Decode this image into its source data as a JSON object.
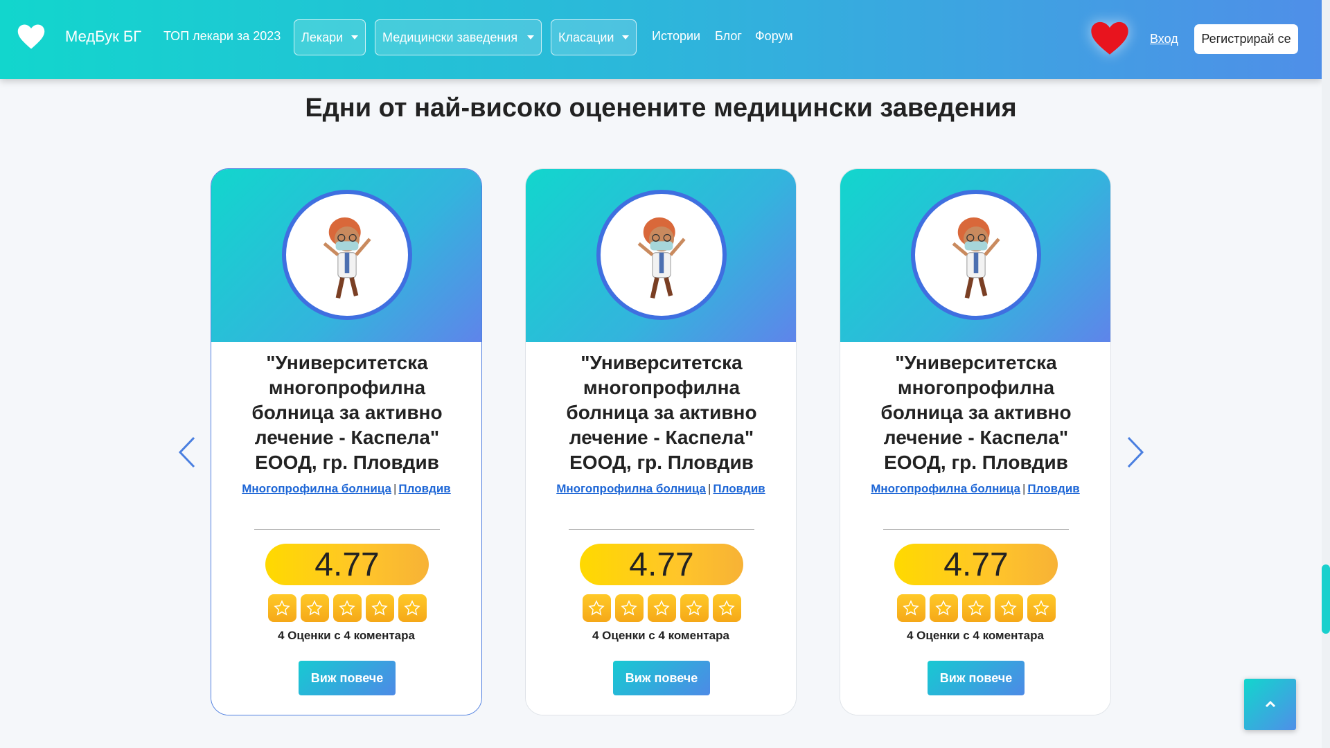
{
  "nav": {
    "brand": "МедБук БГ",
    "top_doctors": "ТОП лекари за 2023",
    "dropdowns": [
      "Лекари",
      "Медицински заведения",
      "Класации"
    ],
    "links": [
      "Истории",
      "Блог",
      "Форум"
    ],
    "login": "Вход",
    "register": "Регистрирай се"
  },
  "section_title": "Едни от най-високо оценените медицински заведения",
  "cards": [
    {
      "name": "\"Университетска многопрофилна болница за активно лечение - Каспела\" ЕООД, гр. Пловдив",
      "type": "Многопрофилна болница",
      "city": "Пловдив",
      "score": "4.77",
      "stars": 5,
      "reviews": "4 Оценки с 4 коментара",
      "button": "Виж повече"
    },
    {
      "name": "\"Университетска многопрофилна болница за активно лечение - Каспела\" ЕООД, гр. Пловдив",
      "type": "Многопрофилна болница",
      "city": "Пловдив",
      "score": "4.77",
      "stars": 5,
      "reviews": "4 Оценки с 4 коментара",
      "button": "Виж повече"
    },
    {
      "name": "\"Университетска многопрофилна болница за активно лечение - Каспела\" ЕООД, гр. Пловдив",
      "type": "Многопрофилна болница",
      "city": "Пловдив",
      "score": "4.77",
      "stars": 5,
      "reviews": "4 Оценки с 4 коментара",
      "button": "Виж повече"
    }
  ],
  "icons": {
    "brand": "heart-icon",
    "favorites": "heart-icon",
    "prev": "chevron-left-icon",
    "next": "chevron-right-icon",
    "scroll_top": "chevron-up-icon",
    "star": "star-icon",
    "avatar": "doctor-illustration"
  },
  "colors": {
    "gradient_start": "#12d6cd",
    "gradient_end": "#4f8fe8",
    "score_yellow": "#ffd900",
    "link_blue": "#1d66d6",
    "heart_red": "#e8141e"
  }
}
